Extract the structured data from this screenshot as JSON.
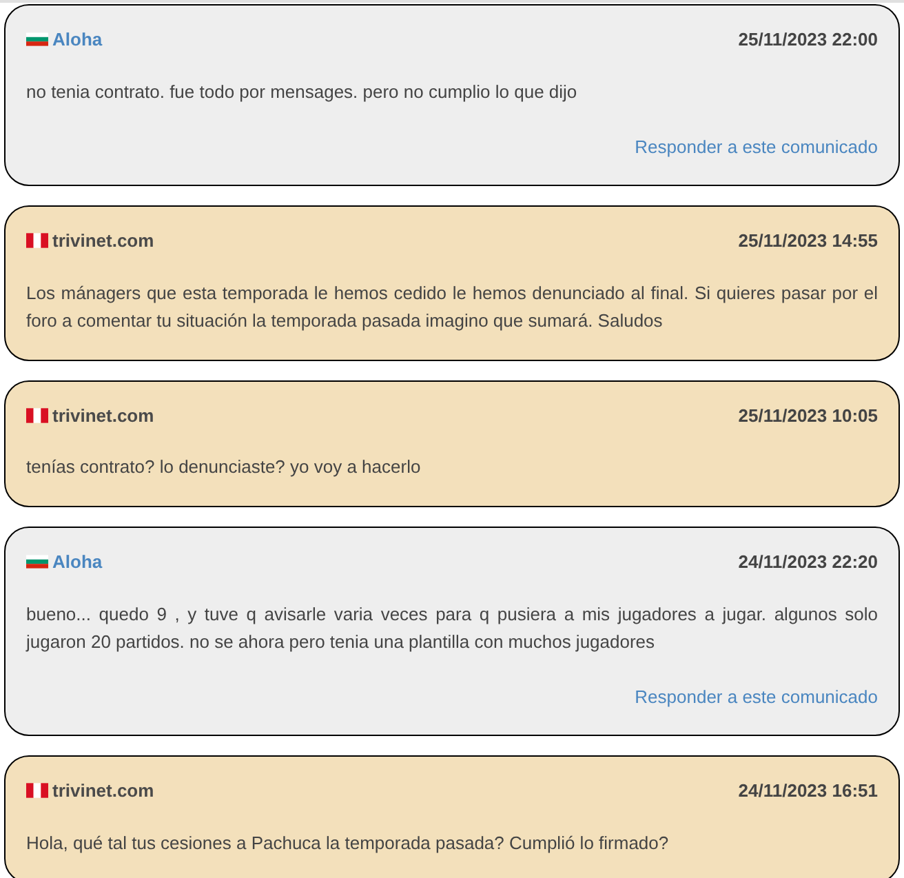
{
  "messages": [
    {
      "kind": "guest",
      "author": "Aloha",
      "date": "25/11/2023 22:00",
      "text": "no tenia contrato. fue todo por mensages. pero no cumplio lo que dijo",
      "reply": "Responder a este comunicado"
    },
    {
      "kind": "host",
      "author": "trivinet.com",
      "date": "25/11/2023 14:55",
      "text": "Los mánagers que esta temporada le hemos cedido le hemos denunciado al final. Si quieres pasar por el foro a comentar tu situación la temporada pasada imagino que sumará. Saludos"
    },
    {
      "kind": "host",
      "author": "trivinet.com",
      "date": "25/11/2023 10:05",
      "text": "tenías contrato? lo denunciaste? yo voy a hacerlo"
    },
    {
      "kind": "guest",
      "author": "Aloha",
      "date": "24/11/2023 22:20",
      "text": "bueno... quedo 9 , y tuve q avisarle varia veces para q pusiera a mis jugadores a jugar. algunos solo jugaron 20 partidos. no se ahora pero tenia una plantilla con muchos jugadores",
      "reply": "Responder a este comunicado"
    },
    {
      "kind": "host",
      "author": "trivinet.com",
      "date": "24/11/2023 16:51",
      "text": "Hola, qué tal tus cesiones a Pachuca la temporada pasada? Cumplió lo firmado?"
    }
  ]
}
